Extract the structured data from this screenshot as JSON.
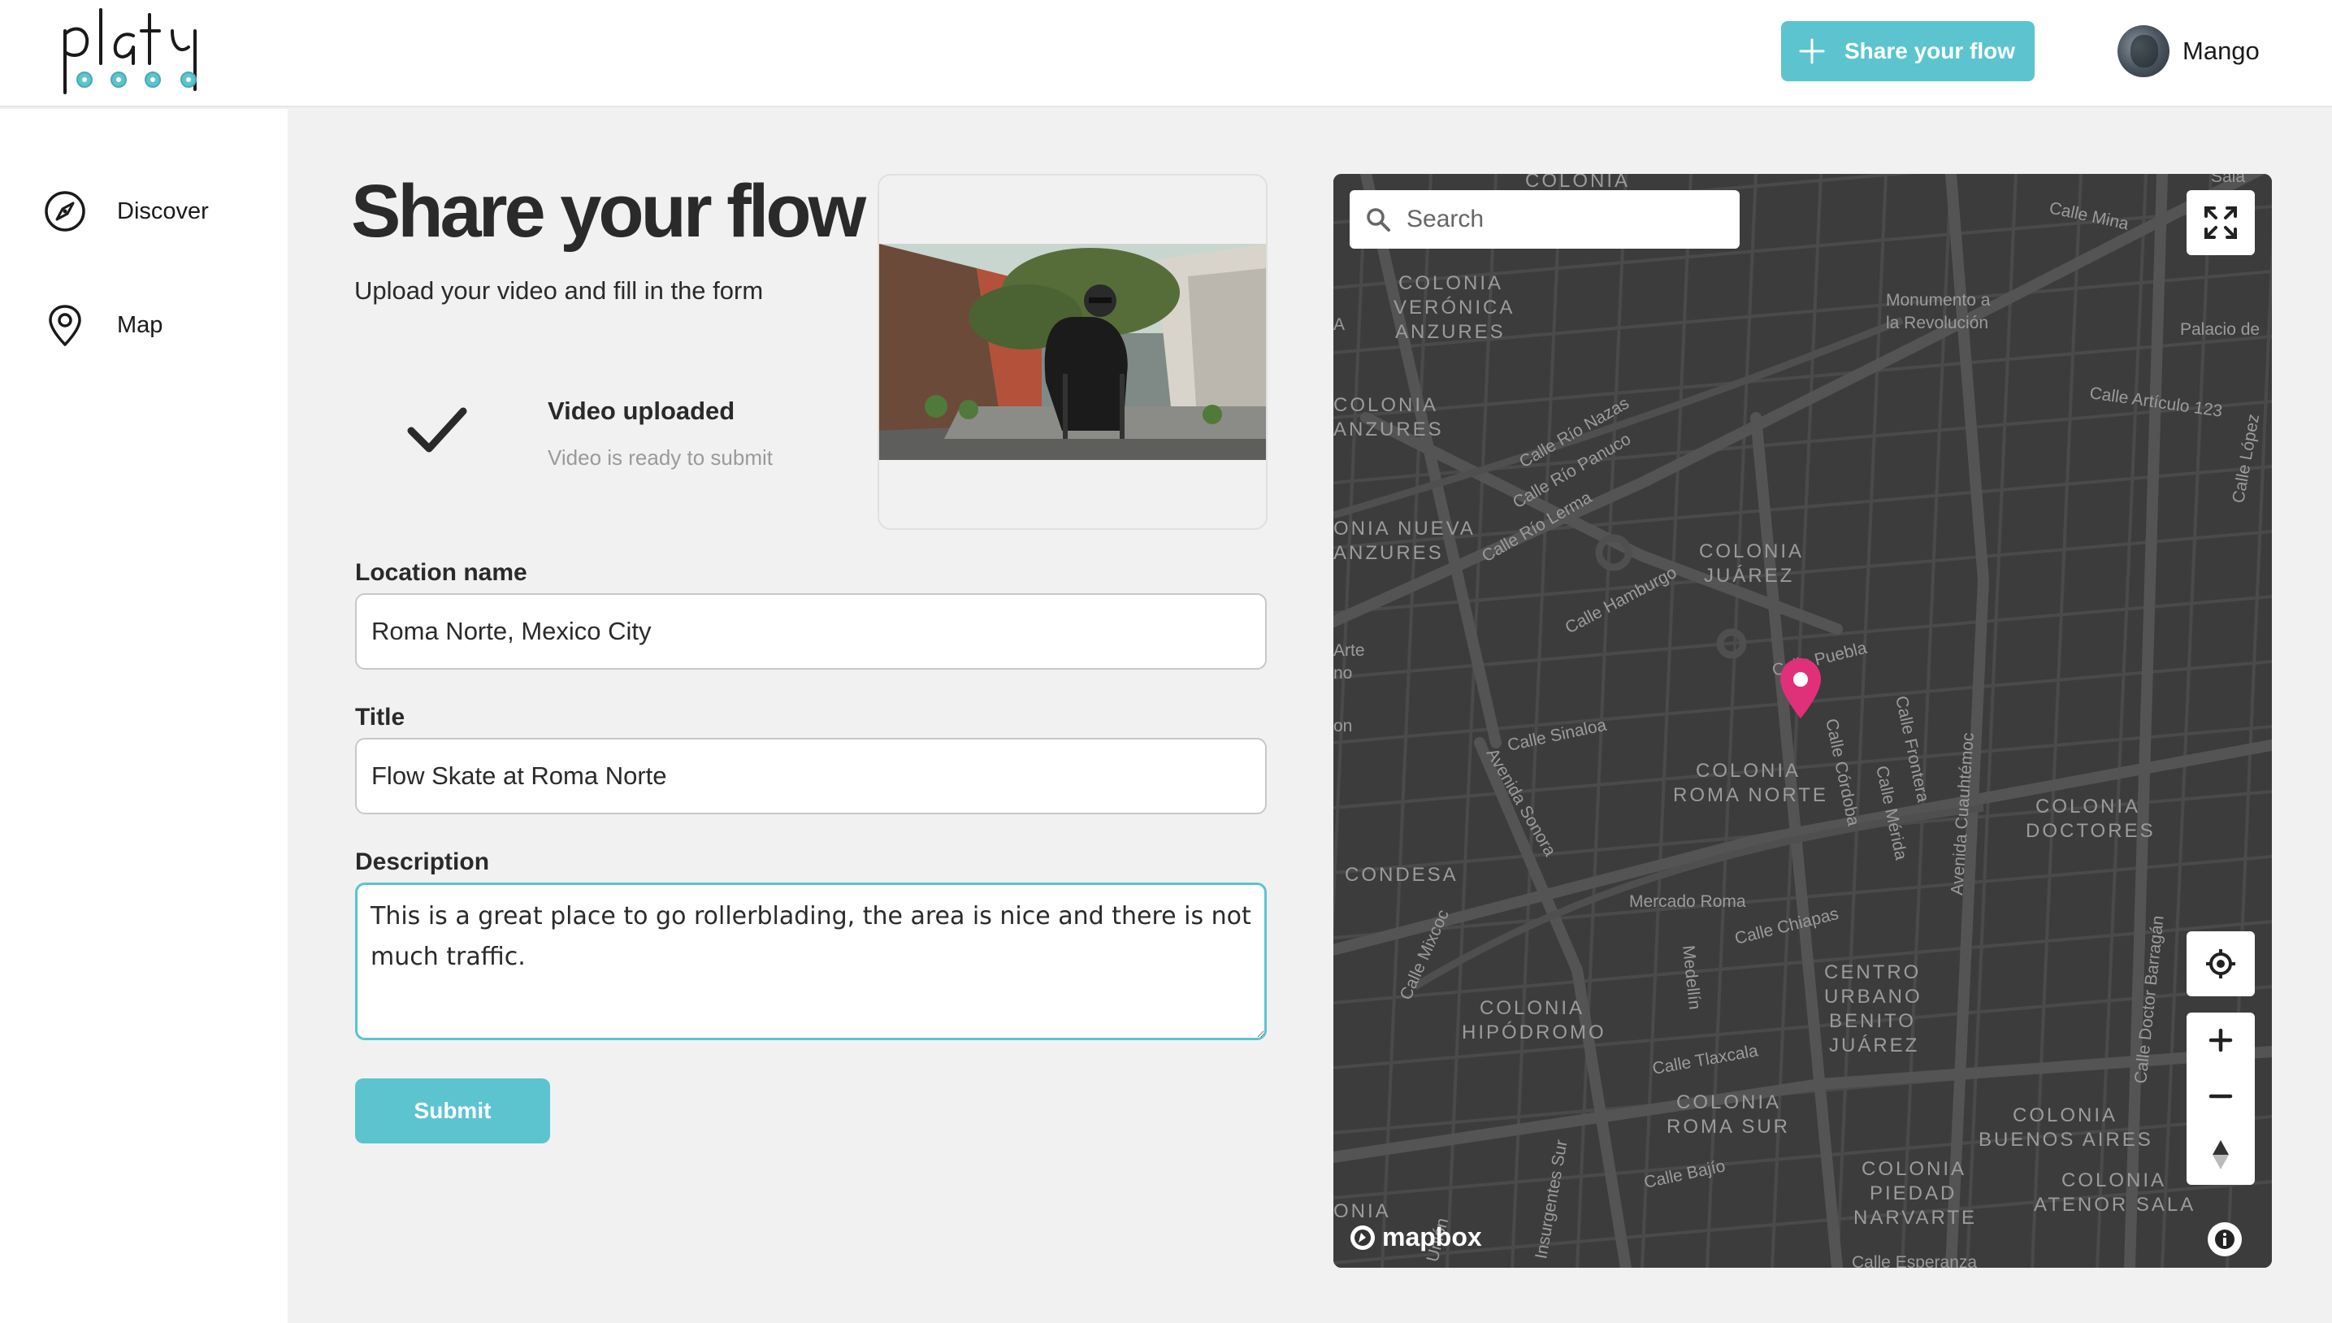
{
  "header": {
    "logo_text": "platy",
    "share_button_label": "Share your flow",
    "user_name": "Mango"
  },
  "sidebar": {
    "items": [
      {
        "label": "Discover",
        "icon": "compass-icon"
      },
      {
        "label": "Map",
        "icon": "map-pin-icon"
      }
    ]
  },
  "form": {
    "title": "Share your flow",
    "subtitle": "Upload your video and fill in the form",
    "upload_status_title": "Video uploaded",
    "upload_status_sub": "Video is ready to submit",
    "location_label": "Location name",
    "location_value": "Roma Norte, Mexico City",
    "title_label": "Title",
    "title_value": "Flow Skate at Roma Norte",
    "description_label": "Description",
    "description_value": "This is a great place to go rollerblading, the area is nice and there is not much traffic.",
    "submit_label": "Submit"
  },
  "map": {
    "search_placeholder": "Search",
    "attribution": "mapbox",
    "colors": {
      "background": "#3a3a3a",
      "roads": "#4e4e4e",
      "pin": "#e0307a",
      "labels": "#9a9a9a"
    },
    "labels": {
      "top_colonia": "COLONIA",
      "veronica_1": "COLONIA",
      "veronica_2": "VERÓNICA",
      "veronica_3": "ANZURES",
      "anzures_1": "COLONIA",
      "anzures_2": "ANZURES",
      "nueva_1": "ONIA NUEVA",
      "nueva_2": "ANZURES",
      "juarez_1": "COLONIA",
      "juarez_2": "JUÁREZ",
      "roma_norte_1": "COLONIA",
      "roma_norte_2": "ROMA NORTE",
      "doctores_1": "COLONIA",
      "doctores_2": "DOCTORES",
      "condesa": "CONDESA",
      "hipodromo_1": "COLONIA",
      "hipodromo_2": "HIPÓDROMO",
      "roma_sur_1": "COLONIA",
      "roma_sur_2": "ROMA SUR",
      "centro_1": "CENTRO",
      "centro_2": "URBANO",
      "centro_3": "BENITO",
      "centro_4": "JUÁREZ",
      "buenos_1": "COLONIA",
      "buenos_2": "BUENOS AIRES",
      "piedad_1": "COLONIA",
      "piedad_2": "PIEDAD",
      "piedad_3": "NARVARTE",
      "atenor_1": "COLONIA",
      "atenor_2": "ATENOR SALA",
      "left_nia": "ONIA",
      "monumento_1": "Monumento a",
      "monumento_2": "la Revolución",
      "palacio": "Palacio de",
      "calle_mina": "Calle Mina",
      "calle_articulo": "Calle Artículo 123",
      "calle_lopez": "Calle López",
      "rio_nazas": "Calle Río Nazas",
      "rio_panuco": "Calle Río Panuco",
      "rio_lerma": "Calle Río Lerma",
      "hamburgo": "Calle Hamburgo",
      "puebla": "Calle Puebla",
      "sinaloa": "Calle Sinaloa",
      "sonora": "Avenida Sonora",
      "cordoba": "Calle Córdoba",
      "merida": "Calle Mérida",
      "frontera": "Calle Frontera",
      "cuauhtemoc": "Avenida Cuauhtémoc",
      "mercado": "Mercado Roma",
      "chiapas": "Calle Chiapas",
      "medellin": "Medellín",
      "mixcoc": "Calle Mixcoc",
      "tlaxcala": "Calle Tlaxcala",
      "bajio": "Calle Bajío",
      "insurgentes": "Insurgentes Sur",
      "union": "Unión",
      "barragan": "Calle Doctor Barragán",
      "esperanza": "Calle Esperanza",
      "arte": "Arte",
      "no": "no",
      "on": "on",
      "left_a": "A",
      "sala": "Sala"
    }
  }
}
